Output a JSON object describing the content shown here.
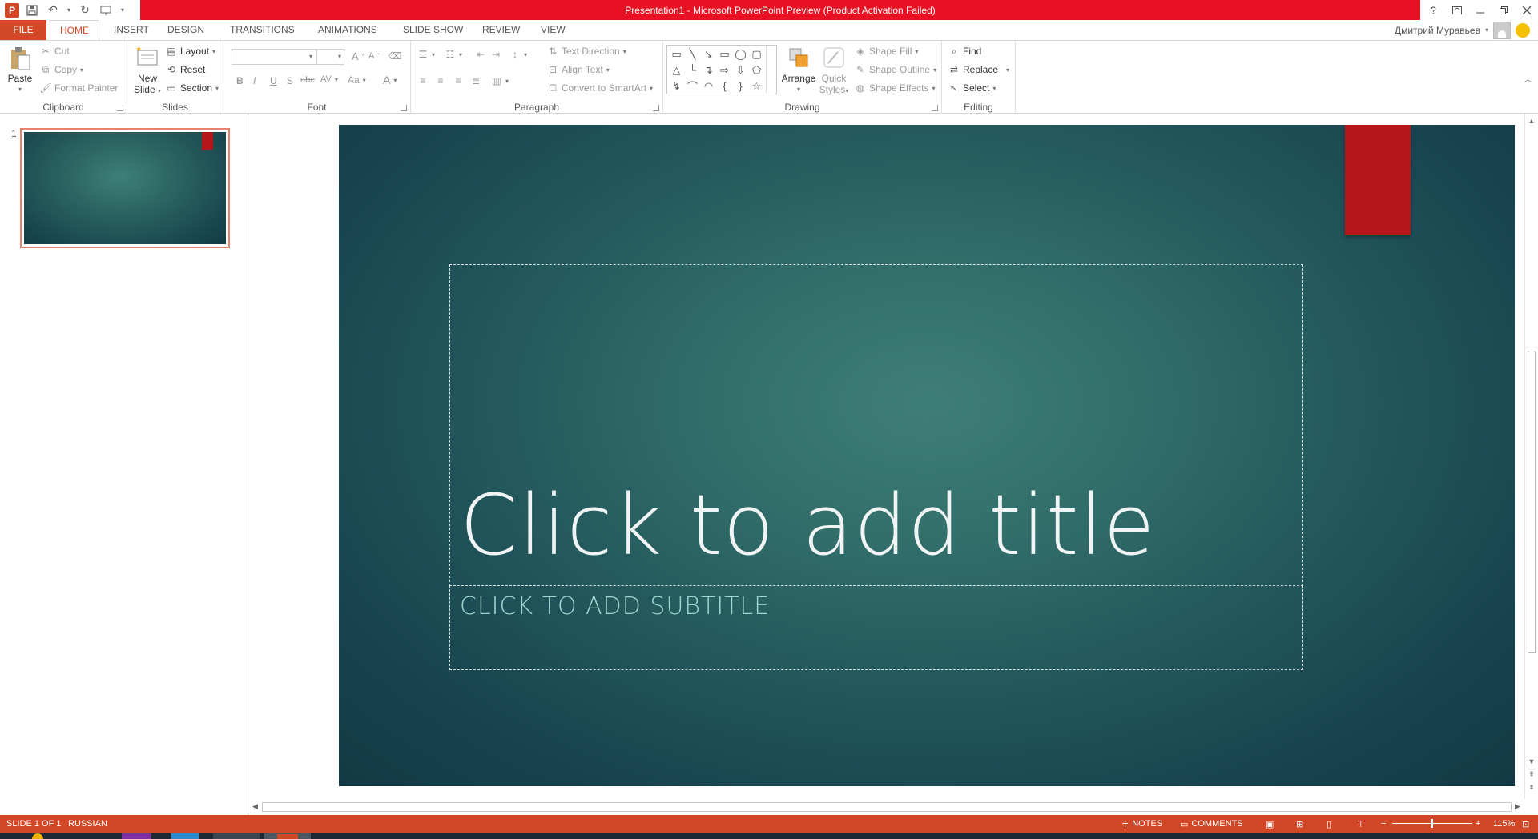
{
  "window": {
    "title": "Presentation1 -  Microsoft PowerPoint Preview (Product Activation Failed)",
    "help_label": "?",
    "user_name": "Дмитрий Муравьев"
  },
  "tabs": {
    "file": "FILE",
    "items": [
      "HOME",
      "INSERT",
      "DESIGN",
      "TRANSITIONS",
      "ANIMATIONS",
      "SLIDE SHOW",
      "REVIEW",
      "VIEW"
    ],
    "active": "HOME"
  },
  "ribbon": {
    "clipboard": {
      "label": "Clipboard",
      "paste": "Paste",
      "cut": "Cut",
      "copy": "Copy",
      "format_painter": "Format Painter"
    },
    "slides": {
      "label": "Slides",
      "new_slide": "New Slide",
      "new_slide_line1": "New",
      "new_slide_line2": "Slide",
      "layout": "Layout",
      "reset": "Reset",
      "section": "Section"
    },
    "font": {
      "label": "Font",
      "bold": "B",
      "italic": "I",
      "underline": "U",
      "shadow": "S",
      "strike": "abc",
      "spacing": "AV",
      "case": "Aa",
      "color": "A",
      "grow": "A",
      "shrink": "A"
    },
    "paragraph": {
      "label": "Paragraph",
      "text_direction": "Text Direction",
      "align_text": "Align Text",
      "convert_smartart": "Convert to SmartArt"
    },
    "drawing": {
      "label": "Drawing",
      "arrange": "Arrange",
      "quick_styles_line1": "Quick",
      "quick_styles_line2": "Styles",
      "shape_fill": "Shape Fill",
      "shape_outline": "Shape Outline",
      "shape_effects": "Shape Effects"
    },
    "editing": {
      "label": "Editing",
      "find": "Find",
      "replace": "Replace",
      "select": "Select"
    }
  },
  "thumbnails": [
    {
      "number": "1"
    }
  ],
  "slide": {
    "title_placeholder": "Click to add title",
    "subtitle_placeholder": "CLICK TO ADD SUBTITLE"
  },
  "status": {
    "slide_info": "SLIDE 1 OF 1",
    "language": "RUSSIAN",
    "notes": "NOTES",
    "comments": "COMMENTS",
    "zoom": "115%",
    "zoom_minus": "−",
    "zoom_plus": "+"
  },
  "colors": {
    "accent": "#d24726",
    "title_bar_error": "#e81123",
    "slide_bg": "#245a5e",
    "slide_accent_red": "#b5161a"
  }
}
